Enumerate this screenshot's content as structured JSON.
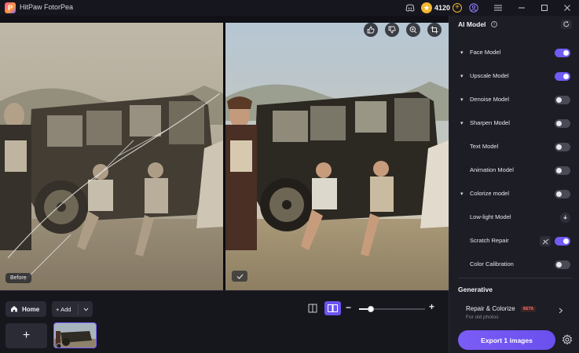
{
  "app": {
    "title": "HitPaw FotorPea",
    "logo_letter": "P"
  },
  "titlebar": {
    "coin_count": "4120",
    "icons": [
      "discord-icon",
      "coin-icon",
      "add-coins-icon",
      "account-icon",
      "menu-icon",
      "minimize-icon",
      "maximize-icon",
      "close-icon"
    ]
  },
  "canvas": {
    "before_label": "Before",
    "tools": [
      "like-icon",
      "dislike-icon",
      "zoom-icon",
      "crop-icon"
    ]
  },
  "panel": {
    "title": "AI Model",
    "info_glyph": "i",
    "models": [
      {
        "label": "Face Model",
        "caret": true,
        "toggle": "on"
      },
      {
        "label": "Upscale Model",
        "caret": true,
        "toggle": "on"
      },
      {
        "label": "Denoise Model",
        "caret": true,
        "toggle": "off"
      },
      {
        "label": "Sharpen Model",
        "caret": true,
        "toggle": "off"
      },
      {
        "label": "Text Model",
        "caret": false,
        "toggle": "off"
      },
      {
        "label": "Animation Model",
        "caret": false,
        "toggle": "off"
      },
      {
        "label": "Colorize model",
        "caret": true,
        "toggle": "off"
      },
      {
        "label": "Low-light Model",
        "caret": false,
        "toggle": "download"
      },
      {
        "label": "Scratch Repair",
        "caret": false,
        "toggle": "on"
      },
      {
        "label": "Color Calibration",
        "caret": false,
        "toggle": "off"
      }
    ],
    "generative": {
      "heading": "Generative",
      "item_title": "Repair & Colorize",
      "badge": "BETA",
      "item_subtitle": "For old photos"
    },
    "export_label": "Export 1 images"
  },
  "bottom": {
    "home_label": "Home",
    "add_label": "Add",
    "add_tile_glyph": "+",
    "zoom_minus": "−",
    "zoom_plus": "+",
    "zoom_level": 0.18
  },
  "colors": {
    "accent": "#6f5cf5",
    "panel_bg": "#1d1d26",
    "coin": "#f2b632",
    "beta": "#ff6a6a"
  }
}
